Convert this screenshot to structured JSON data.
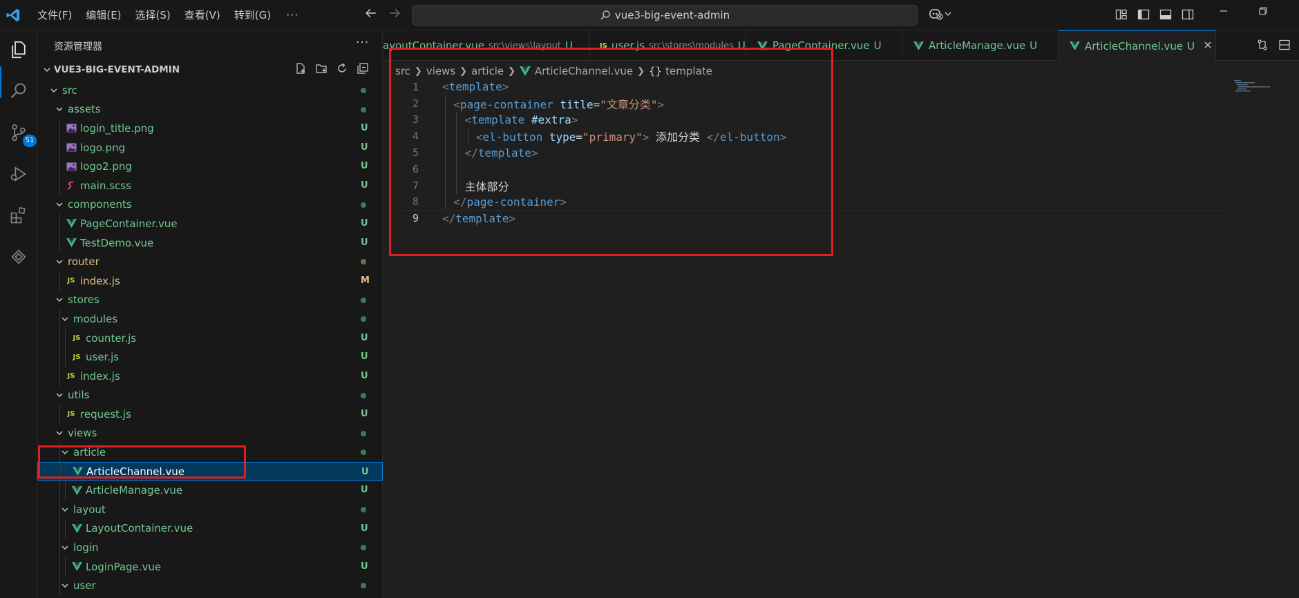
{
  "titlebar": {
    "menus": [
      "文件(F)",
      "编辑(E)",
      "选择(S)",
      "查看(V)",
      "转到(G)"
    ],
    "more": "···",
    "search_text": "vue3-big-event-admin"
  },
  "activity": {
    "scm_badge": "51"
  },
  "sidebar": {
    "title": "资源管理器",
    "more": "···",
    "project": "VUE3-BIG-EVENT-ADMIN",
    "items": [
      {
        "label": "src",
        "type": "folder",
        "depth": 0,
        "status": "dot"
      },
      {
        "label": "assets",
        "type": "folder",
        "depth": 1,
        "status": "dot"
      },
      {
        "label": "login_title.png",
        "type": "img",
        "depth": 2,
        "status": "U"
      },
      {
        "label": "logo.png",
        "type": "img",
        "depth": 2,
        "status": "U"
      },
      {
        "label": "logo2.png",
        "type": "img",
        "depth": 2,
        "status": "U"
      },
      {
        "label": "main.scss",
        "type": "scss",
        "depth": 2,
        "status": "U"
      },
      {
        "label": "components",
        "type": "folder",
        "depth": 1,
        "status": "dot"
      },
      {
        "label": "PageContainer.vue",
        "type": "vue",
        "depth": 2,
        "status": "U"
      },
      {
        "label": "TestDemo.vue",
        "type": "vue",
        "depth": 2,
        "status": "U"
      },
      {
        "label": "router",
        "type": "folder",
        "depth": 1,
        "status": "dotmod"
      },
      {
        "label": "index.js",
        "type": "js",
        "depth": 2,
        "status": "M"
      },
      {
        "label": "stores",
        "type": "folder",
        "depth": 1,
        "status": "dot"
      },
      {
        "label": "modules",
        "type": "folder",
        "depth": 2,
        "status": "dot"
      },
      {
        "label": "counter.js",
        "type": "js",
        "depth": 3,
        "status": "U"
      },
      {
        "label": "user.js",
        "type": "js",
        "depth": 3,
        "status": "U"
      },
      {
        "label": "index.js",
        "type": "js",
        "depth": 2,
        "status": "U"
      },
      {
        "label": "utils",
        "type": "folder",
        "depth": 1,
        "status": "dot"
      },
      {
        "label": "request.js",
        "type": "js",
        "depth": 2,
        "status": "U"
      },
      {
        "label": "views",
        "type": "folder",
        "depth": 1,
        "status": "dot"
      },
      {
        "label": "article",
        "type": "folder",
        "depth": 2,
        "status": "dot"
      },
      {
        "label": "ArticleChannel.vue",
        "type": "vue",
        "depth": 3,
        "status": "U",
        "selected": true
      },
      {
        "label": "ArticleManage.vue",
        "type": "vue",
        "depth": 3,
        "status": "U"
      },
      {
        "label": "layout",
        "type": "folder",
        "depth": 2,
        "status": "dot"
      },
      {
        "label": "LayoutContainer.vue",
        "type": "vue",
        "depth": 3,
        "status": "U"
      },
      {
        "label": "login",
        "type": "folder",
        "depth": 2,
        "status": "dot"
      },
      {
        "label": "LoginPage.vue",
        "type": "vue",
        "depth": 3,
        "status": "U"
      },
      {
        "label": "user",
        "type": "folder",
        "depth": 2,
        "status": "dot"
      }
    ]
  },
  "tabs": [
    {
      "name": "ayoutContainer.vue",
      "path": "src\\views\\layout",
      "status": "U",
      "type": "vue"
    },
    {
      "name": "user.js",
      "path": "src\\stores\\modules",
      "status": "U",
      "type": "js"
    },
    {
      "name": "PageContainer.vue",
      "path": "",
      "status": "U",
      "type": "vue"
    },
    {
      "name": "ArticleManage.vue",
      "path": "",
      "status": "U",
      "type": "vue"
    },
    {
      "name": "ArticleChannel.vue",
      "path": "",
      "status": "U",
      "type": "vue",
      "active": true
    }
  ],
  "breadcrumb": {
    "parts": [
      "src",
      "views",
      "article",
      "ArticleChannel.vue",
      "template"
    ]
  },
  "code": {
    "lines": [
      {
        "n": "1",
        "indent": 0,
        "tokens": [
          [
            "br",
            "<"
          ],
          [
            "tag",
            "template"
          ],
          [
            "br",
            ">"
          ]
        ]
      },
      {
        "n": "2",
        "indent": 1,
        "tokens": [
          [
            "br",
            "<"
          ],
          [
            "tag",
            "page-container"
          ],
          [
            "txt",
            " "
          ],
          [
            "attr",
            "title"
          ],
          [
            "txt",
            "="
          ],
          [
            "str",
            "\"文章分类\""
          ],
          [
            "br",
            ">"
          ]
        ]
      },
      {
        "n": "3",
        "indent": 2,
        "tokens": [
          [
            "br",
            "<"
          ],
          [
            "tag",
            "template"
          ],
          [
            "txt",
            " "
          ],
          [
            "attr",
            "#extra"
          ],
          [
            "br",
            ">"
          ]
        ]
      },
      {
        "n": "4",
        "indent": 3,
        "tokens": [
          [
            "br",
            "<"
          ],
          [
            "tag",
            "el-button"
          ],
          [
            "txt",
            " "
          ],
          [
            "attr",
            "type"
          ],
          [
            "txt",
            "="
          ],
          [
            "str",
            "\"primary\""
          ],
          [
            "br",
            ">"
          ],
          [
            "txt",
            " 添加分类 "
          ],
          [
            "br",
            "</"
          ],
          [
            "tag",
            "el-button"
          ],
          [
            "br",
            ">"
          ]
        ]
      },
      {
        "n": "5",
        "indent": 2,
        "tokens": [
          [
            "br",
            "</"
          ],
          [
            "tag",
            "template"
          ],
          [
            "br",
            ">"
          ]
        ]
      },
      {
        "n": "6",
        "indent": 0,
        "tokens": []
      },
      {
        "n": "7",
        "indent": 2,
        "tokens": [
          [
            "txt",
            "主体部分"
          ]
        ]
      },
      {
        "n": "8",
        "indent": 1,
        "tokens": [
          [
            "br",
            "</"
          ],
          [
            "tag",
            "page-container"
          ],
          [
            "br",
            ">"
          ]
        ]
      },
      {
        "n": "9",
        "indent": 0,
        "tokens": [
          [
            "br",
            "</"
          ],
          [
            "tag",
            "template"
          ],
          [
            "br",
            ">"
          ]
        ],
        "current": true
      }
    ]
  },
  "colors": {
    "accent": "#0078d4",
    "annotation": "#e02020",
    "untracked": "#73c991",
    "modified": "#e2c08d"
  }
}
